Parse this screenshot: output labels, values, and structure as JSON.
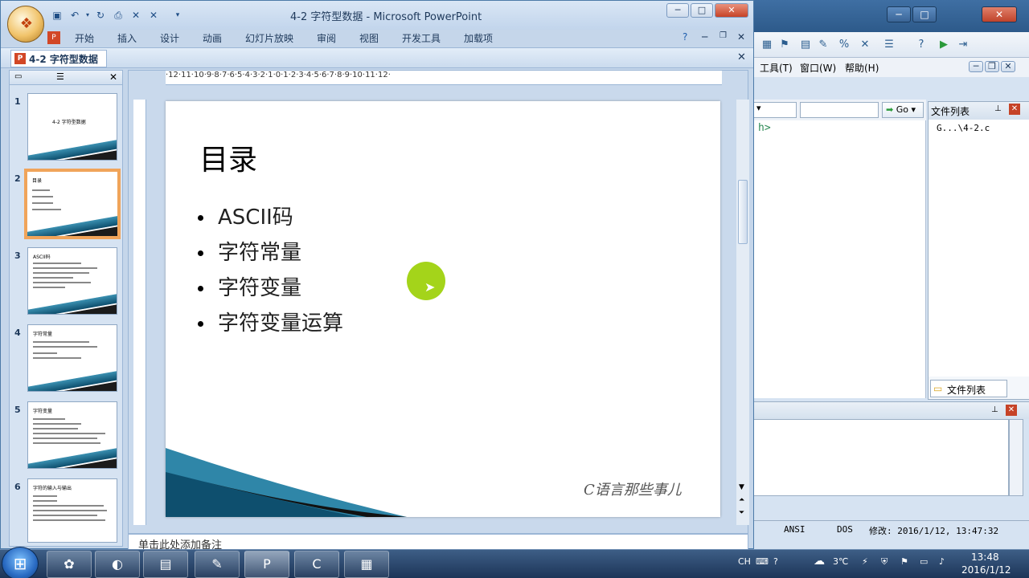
{
  "ppt": {
    "title": "4-2 字符型数据 - Microsoft PowerPoint",
    "tabs": [
      "开始",
      "插入",
      "设计",
      "动画",
      "幻灯片放映",
      "审阅",
      "视图",
      "开发工具",
      "加载项"
    ],
    "doc_tab": "4-2 字符型数据",
    "thumbnails": [
      {
        "num": "1",
        "title": "4-2 字符型数据"
      },
      {
        "num": "2",
        "title": "目录"
      },
      {
        "num": "3",
        "title": "ASCII码"
      },
      {
        "num": "4",
        "title": "字符常量"
      },
      {
        "num": "5",
        "title": "字符变量"
      },
      {
        "num": "6",
        "title": "字符的输入与输出"
      }
    ],
    "ruler": "·12·11·10·9·8·7·6·5·4·3·2·1·0·1·2·3·4·5·6·7·8·9·10·11·12·",
    "slide": {
      "title": "目录",
      "bullets": [
        "ASCII码",
        "字符常量",
        "字符变量",
        "字符变量运算"
      ],
      "signature": "C语言那些事儿"
    },
    "notes": "单击此处添加备注"
  },
  "ide": {
    "menu": [
      "工具(T)",
      "窗口(W)",
      "帮助(H)"
    ],
    "go_label": "Go",
    "code_fragment": "h>",
    "file_panel_title": "文件列表",
    "file_item": "G...\\4-2.c",
    "file_tab": "文件列表",
    "status": {
      "encoding": "ANSI",
      "line_ending": "DOS",
      "modified": "修改: 2016/1/12, 13:47:32"
    }
  },
  "taskbar": {
    "lang": "CH",
    "temperature": "3℃",
    "time": "13:48",
    "date": "2016/1/12"
  },
  "colors": {
    "accent_orange": "#f0a45a",
    "cursor_highlight": "#a4d41a",
    "slide_teal": "#0e4f6e"
  }
}
